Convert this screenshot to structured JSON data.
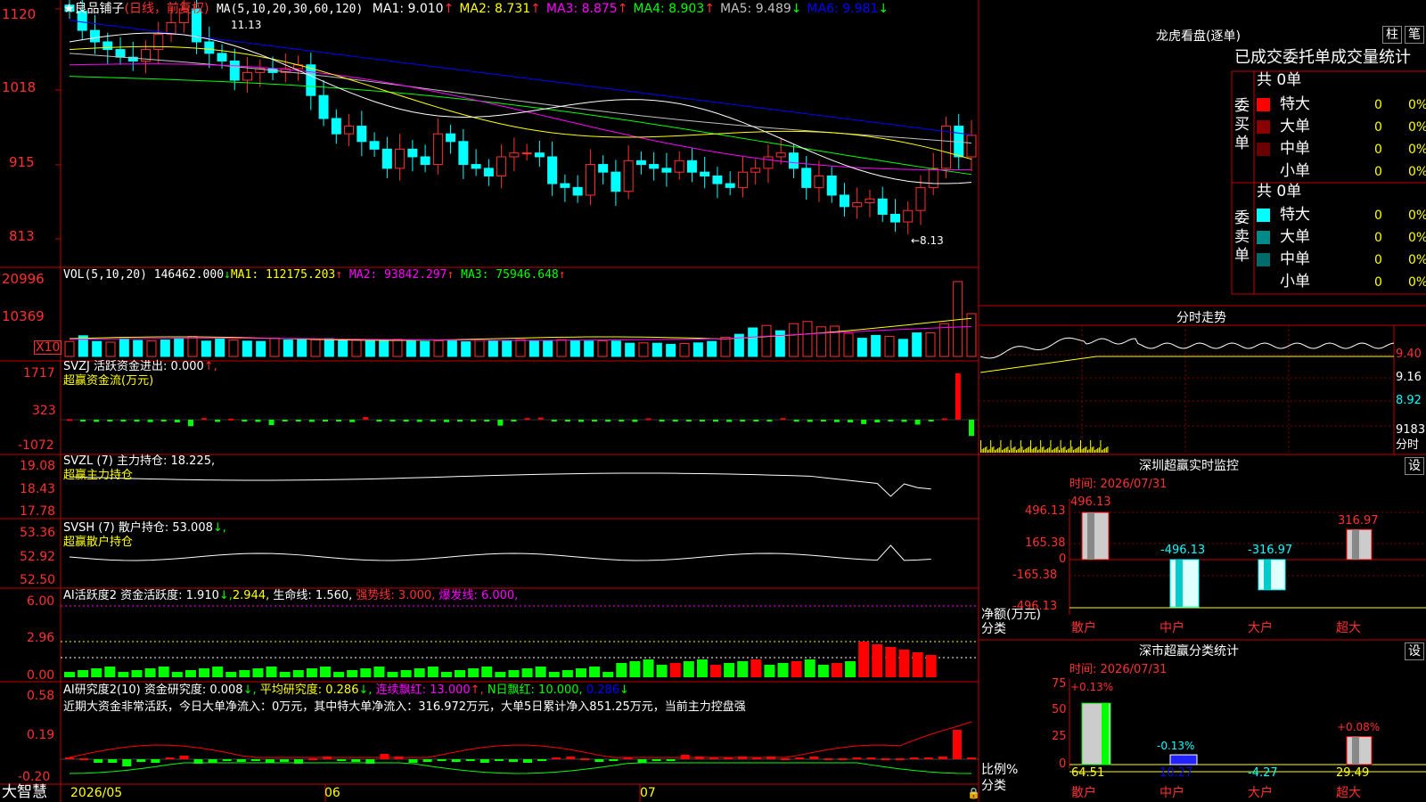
{
  "app": {
    "brand": "大智慧"
  },
  "stock": {
    "name": "★良品铺子",
    "mode": "(日线，前复权)",
    "ma_title": "MA(5,10,20,30,60,120)",
    "ma": [
      {
        "label": "MA1: 9.010",
        "arrow": "↑",
        "color": "#ffffff"
      },
      {
        "label": "MA2: 8.731",
        "arrow": "↑",
        "color": "#ffff00"
      },
      {
        "label": "MA3: 8.875",
        "arrow": "↑",
        "color": "#ff00ff"
      },
      {
        "label": "MA4: 8.903",
        "arrow": "↑",
        "color": "#00ff00"
      },
      {
        "label": "MA5: 9.489",
        "arrow": "↓",
        "color": "#c0c0c0"
      },
      {
        "label": "MA6: 9.981",
        "arrow": "↓",
        "color": "#0000ff"
      }
    ],
    "high_label": "11.13",
    "low_label": "←8.13"
  },
  "axes": {
    "price": [
      "1120",
      "1018",
      "915",
      "813"
    ],
    "vol": [
      "20996",
      "10369",
      "X10"
    ],
    "svzj": [
      "1717",
      "323",
      "-1072"
    ],
    "svzl": [
      "19.08",
      "18.43",
      "17.78"
    ],
    "svsh": [
      "53.36",
      "52.92",
      "52.50"
    ],
    "ai1": [
      "6.00",
      "2.96",
      "0.00"
    ],
    "ai2": [
      "0.58",
      "0.19",
      "-0.20"
    ]
  },
  "dates": [
    "2026/05",
    "06",
    "07"
  ],
  "panels": {
    "vol": {
      "title": "VOL(5,10,20)",
      "value": "146462.000",
      "arrow": "↓",
      "ma1": "MA1: 112175.203",
      "ma1a": "↑",
      "ma2": "MA2: 93842.297",
      "ma2a": "↑",
      "ma3": "MA3: 75946.648",
      "ma3a": "↑"
    },
    "svzj": {
      "title": "SVZJ",
      "label": "活跃资金进出: 0.000",
      "arrow": "↑,",
      "sub": "超赢资金流(万元)"
    },
    "svzl": {
      "title": "SVZL (7)",
      "label": "主力持仓: 18.225,",
      "sub": "超赢主力持仓"
    },
    "svsh": {
      "title": "SVSH (7)",
      "label": "散户持仓: 53.008",
      "arrow": "↓,",
      "sub": "超赢散户持仓"
    },
    "ai1": {
      "title": "AI活跃度2",
      "label": "资金活跃度: 1.910",
      "a": "↓,",
      "v2": "2.944,",
      "life": "生命线: 1.560,",
      "strong": "强势线: 3.000,",
      "burst": "爆发线: 6.000,"
    },
    "ai2": {
      "title": "AI研究度2(10)",
      "label": "资金研究度: 0.008",
      "a": "↓,",
      "avg": "平均研究度: 0.286",
      "a2": "↓,",
      "cont": "连续飘红: 13.000",
      "a3": "↑,",
      "n": "N日飘红: 10.000,",
      "v": "0.286",
      "a4": "↓",
      "note": "近期大资金非常活跃，今日大单净流入：0万元，其中特大单净流入：316.972万元，大单5日累计净入851.25万元，当前主力控盘强"
    }
  },
  "dragon": {
    "title": "龙虎看盘(逐单)",
    "btn_col": "柱",
    "btn_pen": "笔",
    "subtitle": "已成交委托单成交量统计",
    "buy_label": "委买单",
    "sell_label": "委卖单",
    "buy_total": "共 0单",
    "sell_total": "共 0单",
    "buy_rows": [
      {
        "name": "特大",
        "qty": "0",
        "pct": "0%",
        "color": "#ff0000"
      },
      {
        "name": "大单",
        "qty": "0",
        "pct": "0%",
        "color": "#8b0000"
      },
      {
        "name": "中单",
        "qty": "0",
        "pct": "0%",
        "color": "#6b0000"
      },
      {
        "name": "小单",
        "qty": "0",
        "pct": "0%",
        "color": ""
      }
    ],
    "sell_rows": [
      {
        "name": "特大",
        "qty": "0",
        "pct": "0%",
        "color": "#00ffff"
      },
      {
        "name": "大单",
        "qty": "0",
        "pct": "0%",
        "color": "#008b8b"
      },
      {
        "name": "中单",
        "qty": "0",
        "pct": "0%",
        "color": "#006b6b"
      },
      {
        "name": "小单",
        "qty": "0",
        "pct": "0%",
        "color": ""
      }
    ]
  },
  "intraday": {
    "title": "分时走势",
    "prices": [
      "9.40",
      "9.16",
      "8.92"
    ],
    "volume": "9183",
    "vol_unit": "分时"
  },
  "monitor": {
    "title": "深圳超赢实时监控",
    "btn": "设",
    "time": "时间: 2026/07/31",
    "yaxis": [
      "496.13",
      "165.38",
      "0",
      "-165.38",
      "-496.13"
    ],
    "ylabel": "净额(万元)",
    "xlabel": "分类",
    "cats": [
      "散户",
      "中户",
      "大户",
      "超大"
    ],
    "labels": [
      "496.13",
      "-496.13",
      "-316.97",
      "316.97"
    ]
  },
  "classify": {
    "title": "深市超赢分类统计",
    "btn": "设",
    "time": "时间: 2026/07/31",
    "yaxis": [
      "75",
      "50",
      "25",
      "0"
    ],
    "ylabel": "比例%",
    "xlabel": "分类",
    "cats": [
      "散户",
      "中户",
      "大户",
      "超大"
    ],
    "top": [
      "+0.13%",
      "-0.13%",
      "",
      "+0.08%"
    ],
    "bottom": [
      "64.51",
      "10.27",
      "-4.27",
      "29.49"
    ]
  },
  "chart_data": [
    {
      "type": "candlestick",
      "title": "★良品铺子(日线，前复权)",
      "ylim": [
        8.0,
        11.4
      ],
      "high": 11.13,
      "low": 8.13,
      "close": [
        11.1,
        10.85,
        10.7,
        10.6,
        10.5,
        10.45,
        10.6,
        10.8,
        10.95,
        11.13,
        10.7,
        10.55,
        10.45,
        10.2,
        10.3,
        10.35,
        10.3,
        10.35,
        10.4,
        10.0,
        9.7,
        9.5,
        9.6,
        9.4,
        9.3,
        9.05,
        9.3,
        9.2,
        9.1,
        9.5,
        9.4,
        9.1,
        9.05,
        8.95,
        9.2,
        9.25,
        9.25,
        9.2,
        8.85,
        8.8,
        8.7,
        9.1,
        9.0,
        8.75,
        9.15,
        9.1,
        9.05,
        9.0,
        9.15,
        9.0,
        8.95,
        8.85,
        8.8,
        9.0,
        9.05,
        9.2,
        9.25,
        9.05,
        8.8,
        8.95,
        8.7,
        8.55,
        8.6,
        8.65,
        8.45,
        8.35,
        8.5,
        8.8,
        9.05,
        9.6,
        9.2,
        9.48
      ]
    },
    {
      "type": "bar",
      "title": "VOL(5,10,20)",
      "ylim": [
        0,
        21000
      ],
      "values": [
        4200,
        5800,
        4200,
        4000,
        5000,
        4500,
        4400,
        4600,
        5100,
        5600,
        4300,
        5000,
        4600,
        4300,
        4200,
        5100,
        4600,
        5000,
        4700,
        5000,
        4400,
        4600,
        4400,
        4600,
        4800,
        4300,
        4200,
        4400,
        4500,
        4100,
        4500,
        4400,
        4300,
        4700,
        4400,
        4400,
        4700,
        4500,
        4300,
        4400,
        4300,
        3700,
        3800,
        3700,
        3400,
        3600,
        3800,
        4200,
        5400,
        6200,
        8000,
        8700,
        7200,
        9200,
        9800,
        8300,
        8500,
        6500,
        5100,
        5900,
        5600,
        4800,
        6600,
        6600,
        9200,
        20996,
        12000
      ]
    },
    {
      "type": "bar",
      "title": "SVZJ 超赢资金流(万元)",
      "values": [
        20,
        -40,
        -80,
        -60,
        -50,
        -70,
        -90,
        -60,
        -100,
        -240,
        60,
        -80,
        40,
        -60,
        -80,
        -200,
        -40,
        -60,
        -80,
        -40,
        -60,
        -90,
        100,
        -60,
        -40,
        -70,
        -80,
        -60,
        -90,
        -70,
        -50,
        -60,
        -220,
        -40,
        60,
        80,
        -40,
        -60,
        -80,
        -50,
        -70,
        -60,
        -80,
        50,
        -60,
        -40,
        -50,
        -60,
        -70,
        -80,
        -60,
        -50,
        -40,
        60,
        -70,
        -80,
        -60,
        -90,
        -100,
        -160,
        -100,
        -60,
        -80,
        -180,
        -60,
        50,
        1717,
        -600
      ]
    },
    {
      "type": "bar",
      "title": "AI研究度2(10)",
      "values": [
        0.02,
        0.01,
        -0.04,
        -0.04,
        -0.08,
        -0.03,
        -0.04,
        0.02,
        0.04,
        -0.05,
        -0.04,
        -0.02,
        -0.03,
        -0.02,
        -0.04,
        -0.03,
        -0.05,
        0.01,
        0.03,
        -0.02,
        -0.03,
        -0.05,
        0.06,
        0.03,
        -0.04,
        -0.03,
        -0.02,
        -0.03,
        -0.02,
        -0.04,
        -0.02,
        -0.03,
        -0.04,
        -0.02,
        0.02,
        0.03,
        0.01,
        -0.03,
        -0.02,
        0.02,
        -0.04,
        -0.02,
        -0.02,
        0.05,
        0.03,
        0.02,
        0.02,
        0.03,
        0.02,
        0.03,
        0.01,
        0.02,
        0.03,
        0.01,
        0.01,
        0.02,
        0.02,
        0.01,
        0.01,
        0.02,
        0.02,
        0.03,
        0.33,
        0.02
      ]
    },
    {
      "type": "bar",
      "title": "深圳超赢实时监控",
      "categories": [
        "散户",
        "中户",
        "大户",
        "超大"
      ],
      "values": [
        496.13,
        -496.13,
        -316.97,
        316.97
      ]
    },
    {
      "type": "bar",
      "title": "深市超赢分类统计",
      "categories": [
        "散户",
        "中户",
        "大户",
        "超大"
      ],
      "values": [
        64.51,
        10.27,
        -4.27,
        29.49
      ]
    }
  ]
}
